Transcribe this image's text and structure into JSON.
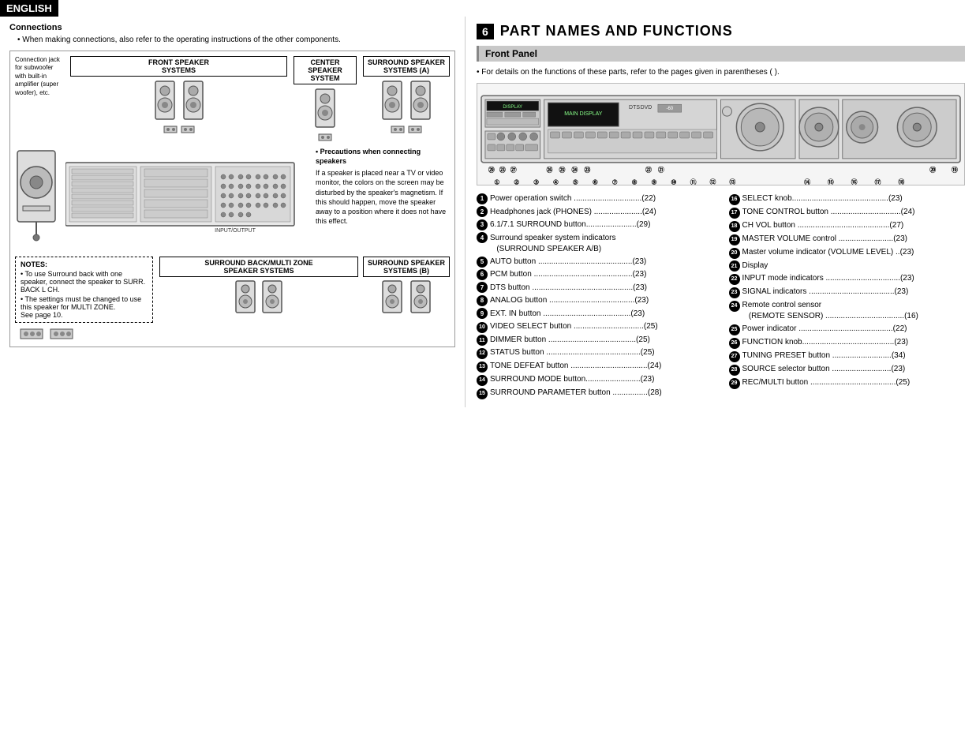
{
  "header": {
    "label": "ENGLISH"
  },
  "left": {
    "connections_title": "Connections",
    "connections_bullet": "When making connections, also refer to the operating instructions of the other components.",
    "speaker_boxes": [
      {
        "title": "FRONT SPEAKER\nSYSTEMS"
      },
      {
        "title": "CENTER SPEAKER\nSYSTEM"
      },
      {
        "title": "SURROUND SPEAKER\nSYSTEMS (A)"
      }
    ],
    "precautions_title": "Precautions when\nconnecting speakers",
    "precautions_text": "If a speaker is placed near a TV or video monitor, the colors on the screen may be disturbed by the speaker's magnetism. If this should happen, move the speaker away to a position where it does not have this effect.",
    "notes_title": "NOTES:",
    "notes_items": [
      "To use Surround back with one speaker, connect the speaker to SURR. BACK L CH.",
      "The settings must be changed to use this speaker for MULTI ZONE.\nSee page 10."
    ],
    "bottom_boxes": [
      {
        "title": "SURROUND BACK/MULTI ZONE\nSPEAKER SYSTEMS"
      },
      {
        "title": "SURROUND SPEAKER\nSYSTEMS (B)"
      }
    ]
  },
  "right": {
    "section_number": "6",
    "section_title": "PART NAMES AND FUNCTIONS",
    "front_panel_label": "Front Panel",
    "panel_note": "For details on the functions of these parts, refer to the pages given in parentheses ( ).",
    "functions_left": [
      {
        "num": "1",
        "label": "Power operation switch",
        "dots": "...............................",
        "page": "(22)"
      },
      {
        "num": "2",
        "label": "Headphones jack (PHONES)",
        "dots": ".....................",
        "page": "(24)"
      },
      {
        "num": "3",
        "label": "6.1/7.1 SURROUND button",
        "dots": "......................",
        "page": "(29)"
      },
      {
        "num": "4",
        "label": "Surround speaker system indicators\n(SURROUND SPEAKER A/B)",
        "dots": "",
        "page": ""
      },
      {
        "num": "5",
        "label": "AUTO button",
        "dots": "...........................................",
        "page": "(23)"
      },
      {
        "num": "6",
        "label": "PCM button",
        "dots": ".............................................",
        "page": "(23)"
      },
      {
        "num": "7",
        "label": "DTS button",
        "dots": ".............................................",
        "page": "(23)"
      },
      {
        "num": "8",
        "label": "ANALOG button",
        "dots": ".......................................",
        "page": "(23)"
      },
      {
        "num": "9",
        "label": "EXT. IN button",
        "dots": "........................................",
        "page": "(23)"
      },
      {
        "num": "10",
        "label": "VIDEO SELECT button",
        "dots": "................................",
        "page": "(25)"
      },
      {
        "num": "11",
        "label": "DIMMER button",
        "dots": "........................................",
        "page": "(25)"
      },
      {
        "num": "12",
        "label": "STATUS button",
        "dots": ".........................................",
        "page": "(25)"
      },
      {
        "num": "13",
        "label": "TONE DEFEAT button",
        "dots": "...................................",
        "page": "(24)"
      },
      {
        "num": "14",
        "label": "SURROUND MODE button",
        "dots": ".........................",
        "page": "(23)"
      },
      {
        "num": "15",
        "label": "SURROUND PARAMETER button",
        "dots": "................",
        "page": "(28)"
      }
    ],
    "functions_right": [
      {
        "num": "16",
        "label": "SELECT knob",
        "dots": "...........................................",
        "page": "(23)"
      },
      {
        "num": "17",
        "label": "TONE CONTROL button",
        "dots": "................................",
        "page": "(24)"
      },
      {
        "num": "18",
        "label": "CH VOL button",
        "dots": "..........................................",
        "page": "(27)"
      },
      {
        "num": "19",
        "label": "MASTER VOLUME control",
        "dots": ".........................",
        "page": "(23)"
      },
      {
        "num": "20",
        "label": "Master volume indicator (VOLUME LEVEL)",
        "dots": "...",
        "page": "(23)"
      },
      {
        "num": "21",
        "label": "Display",
        "dots": "",
        "page": ""
      },
      {
        "num": "22",
        "label": "INPUT mode indicators",
        "dots": "..................................",
        "page": "(23)"
      },
      {
        "num": "23",
        "label": "SIGNAL indicators",
        "dots": ".......................................",
        "page": "(23)"
      },
      {
        "num": "24",
        "label": "Remote control sensor\n(REMOTE SENSOR)",
        "dots": "....................................",
        "page": "(16)"
      },
      {
        "num": "25",
        "label": "Power indicator",
        "dots": "...........................................",
        "page": "(22)"
      },
      {
        "num": "26",
        "label": "FUNCTION knob",
        "dots": "..........................................",
        "page": "(23)"
      },
      {
        "num": "27",
        "label": "TUNING PRESET button",
        "dots": "...........................",
        "page": "(34)"
      },
      {
        "num": "28",
        "label": "SOURCE selector button",
        "dots": "...........................",
        "page": "(23)"
      },
      {
        "num": "29",
        "label": "REC/MULTI button",
        "dots": ".......................................",
        "page": "(25)"
      }
    ]
  }
}
